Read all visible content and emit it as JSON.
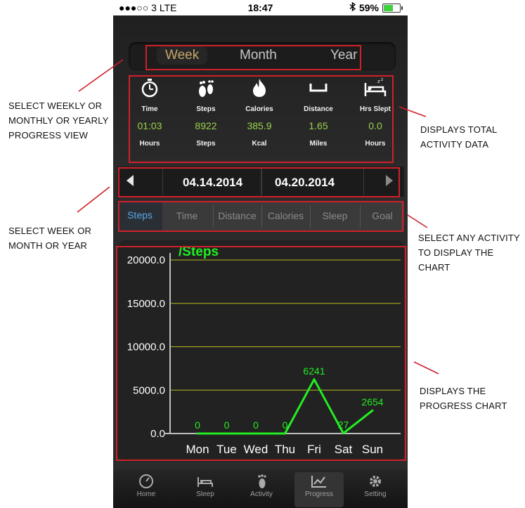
{
  "status": {
    "carrier": "●●●○○ 3  LTE",
    "time": "18:47",
    "battery": "59%",
    "battery_fraction": 0.59
  },
  "period_tabs": [
    {
      "label": "Week",
      "active": true
    },
    {
      "label": "Month",
      "active": false
    },
    {
      "label": "Year",
      "active": false
    }
  ],
  "stats": [
    {
      "icon": "stopwatch-icon",
      "label": "Time",
      "value": "01:03",
      "unit": "Hours"
    },
    {
      "icon": "footprints-icon",
      "label": "Steps",
      "value": "8922",
      "unit": "Steps"
    },
    {
      "icon": "flame-icon",
      "label": "Calories",
      "value": "385.9",
      "unit": "Kcal"
    },
    {
      "icon": "distance-icon",
      "label": "Distance",
      "value": "1.65",
      "unit": "Miles"
    },
    {
      "icon": "bed-icon",
      "label": "Hrs Slept",
      "value": "0.0",
      "unit": "Hours"
    }
  ],
  "date_range": {
    "start": "04.14.2014",
    "end": "04.20.2014"
  },
  "activity_tabs": [
    {
      "label": "Steps",
      "active": true
    },
    {
      "label": "Time",
      "active": false
    },
    {
      "label": "Distance",
      "active": false
    },
    {
      "label": "Calories",
      "active": false
    },
    {
      "label": "Sleep",
      "active": false
    },
    {
      "label": "Goal",
      "active": false
    }
  ],
  "chart_data": {
    "type": "line",
    "title": "/Steps",
    "categories": [
      "Mon",
      "Tue",
      "Wed",
      "Thu",
      "Fri",
      "Sat",
      "Sun"
    ],
    "values": [
      0,
      0,
      0,
      0,
      6241,
      27,
      2654
    ],
    "data_labels": [
      "0",
      "0",
      "0",
      "0",
      "6241",
      "27",
      "2654"
    ],
    "y_ticks": [
      "20000.0",
      "15000.0",
      "10000.0",
      "5000.0",
      "0.0"
    ],
    "y_tick_values": [
      20000,
      15000,
      10000,
      5000,
      0
    ],
    "ylim": [
      0,
      20000
    ],
    "grid": true,
    "colors": {
      "line": "#22ee22",
      "grid": "#b8b820",
      "label": "#ffffff",
      "title": "#22ee22"
    }
  },
  "tab_bar": [
    {
      "icon": "gauge-icon",
      "label": "Home",
      "active": false
    },
    {
      "icon": "bed-icon",
      "label": "Sleep",
      "active": false
    },
    {
      "icon": "footprint-icon",
      "label": "Activity",
      "active": false
    },
    {
      "icon": "chart-icon",
      "label": "Progress",
      "active": true
    },
    {
      "icon": "gear-icon",
      "label": "Setting",
      "active": false
    }
  ],
  "annotations": {
    "select_period": "SELECT WEEKLY OR MONTHLY OR YEARLY PROGRESS VIEW",
    "total_activity": "DISPLAYS TOTAL ACTIVITY DATA",
    "select_range": "SELECT WEEK OR MONTH OR YEAR",
    "select_activity": "SELECT ANY ACTIVITY TO DISPLAY THE CHART",
    "progress_chart": "DISPLAYS THE PROGRESS CHART"
  },
  "colors": {
    "highlight_box": "#d0202a",
    "active_period": "#c7a46a",
    "active_tab": "#5aa8e6",
    "stat_value": "#9bd14a"
  }
}
